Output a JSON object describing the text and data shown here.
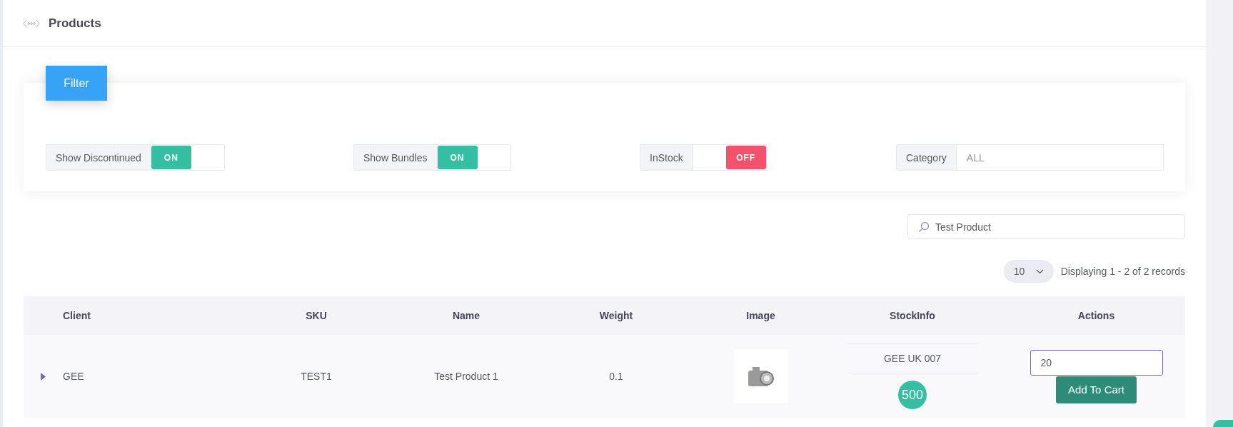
{
  "header": {
    "title": "Products"
  },
  "filter_panel": {
    "button": "Filter",
    "filters": [
      {
        "kind": "toggle",
        "label": "Show Discontinued",
        "on": true,
        "text": "ON"
      },
      {
        "kind": "toggle",
        "label": "Show Bundles",
        "on": true,
        "text": "ON"
      },
      {
        "kind": "toggle",
        "label": "InStock",
        "on": false,
        "text": "OFF"
      },
      {
        "kind": "select",
        "label": "Category",
        "value": "ALL"
      }
    ]
  },
  "search": {
    "value": "Test Product"
  },
  "pagination": {
    "page_size": "10",
    "summary": "Displaying 1 - 2 of 2 records"
  },
  "table": {
    "columns": [
      "Client",
      "SKU",
      "Name",
      "Weight",
      "Image",
      "StockInfo",
      "Actions"
    ],
    "rows": [
      {
        "expanded": false,
        "client": "GEE",
        "sku": "TEST1",
        "name": "Test Product 1",
        "weight": "0.1",
        "stock_location": "GEE UK 007",
        "stock_count": "500",
        "quantity": "20",
        "action": "Add To Cart"
      }
    ]
  }
}
